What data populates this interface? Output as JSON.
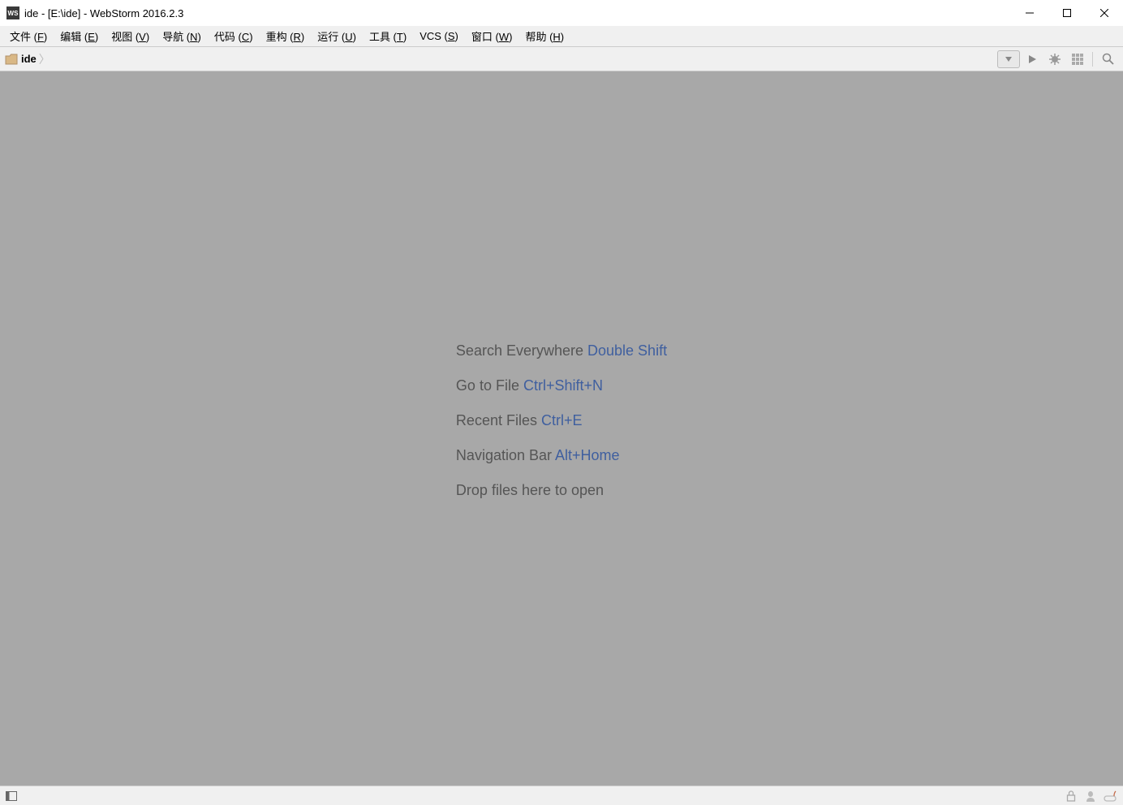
{
  "titlebar": {
    "logo_text": "WS",
    "title": "ide - [E:\\ide] - WebStorm 2016.2.3"
  },
  "menu": {
    "items": [
      {
        "pre": "文件 (",
        "accel": "F",
        "post": ")"
      },
      {
        "pre": "编辑 (",
        "accel": "E",
        "post": ")"
      },
      {
        "pre": "视图 (",
        "accel": "V",
        "post": ")"
      },
      {
        "pre": "导航 (",
        "accel": "N",
        "post": ")"
      },
      {
        "pre": "代码 (",
        "accel": "C",
        "post": ")"
      },
      {
        "pre": "重构 (",
        "accel": "R",
        "post": ")"
      },
      {
        "pre": "运行 (",
        "accel": "U",
        "post": ")"
      },
      {
        "pre": "工具 (",
        "accel": "T",
        "post": ")"
      },
      {
        "pre": "VCS (",
        "accel": "S",
        "post": ")"
      },
      {
        "pre": "窗口 (",
        "accel": "W",
        "post": ")"
      },
      {
        "pre": "帮助 (",
        "accel": "H",
        "post": ")"
      }
    ]
  },
  "breadcrumb": {
    "project": "ide"
  },
  "hints": [
    {
      "label": "Search Everywhere ",
      "shortcut": "Double Shift"
    },
    {
      "label": "Go to File ",
      "shortcut": "Ctrl+Shift+N"
    },
    {
      "label": "Recent Files ",
      "shortcut": "Ctrl+E"
    },
    {
      "label": "Navigation Bar ",
      "shortcut": "Alt+Home"
    },
    {
      "label": "Drop files here to open",
      "shortcut": ""
    }
  ]
}
